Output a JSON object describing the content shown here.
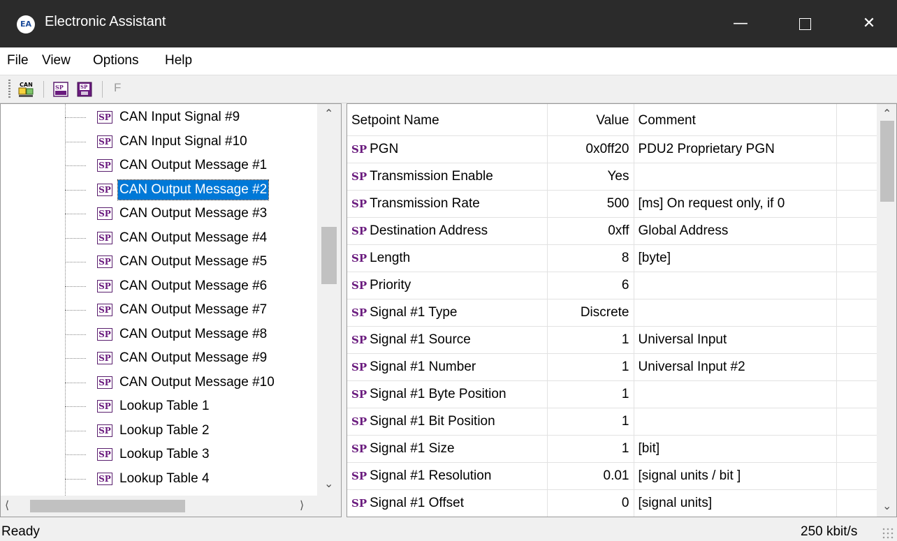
{
  "window": {
    "title": "Electronic Assistant",
    "icon": "ea-logo-icon"
  },
  "menu": [
    "File",
    "View",
    "Options",
    "Help"
  ],
  "toolbar": {
    "f_label": "F"
  },
  "tree": {
    "items": [
      "CAN Input Signal #9",
      "CAN Input Signal #10",
      "CAN Output Message #1",
      "CAN Output Message #2",
      "CAN Output Message #3",
      "CAN Output Message #4",
      "CAN Output Message #5",
      "CAN Output Message #6",
      "CAN Output Message #7",
      "CAN Output Message #8",
      "CAN Output Message #9",
      "CAN Output Message #10",
      "Lookup Table 1",
      "Lookup Table 2",
      "Lookup Table 3",
      "Lookup Table 4"
    ],
    "selected_index": 3,
    "icon_label": "SP"
  },
  "grid": {
    "columns": [
      "Setpoint Name",
      "Value",
      "Comment"
    ],
    "sp_label": "SP",
    "rows": [
      [
        "PGN",
        "0x0ff20",
        "PDU2 Proprietary PGN"
      ],
      [
        "Transmission Enable",
        "Yes",
        ""
      ],
      [
        "Transmission Rate",
        "500",
        "[ms]  On request only, if 0"
      ],
      [
        "Destination Address",
        "0xff",
        "Global Address"
      ],
      [
        "Length",
        "8",
        "[byte]"
      ],
      [
        "Priority",
        "6",
        ""
      ],
      [
        "Signal #1 Type",
        "Discrete",
        ""
      ],
      [
        "Signal #1 Source",
        "1",
        "Universal Input"
      ],
      [
        "Signal #1 Number",
        "1",
        "Universal Input #2"
      ],
      [
        "Signal #1 Byte Position",
        "1",
        ""
      ],
      [
        "Signal #1 Bit Position",
        "1",
        ""
      ],
      [
        "Signal #1 Size",
        "1",
        "[bit]"
      ],
      [
        "Signal #1 Resolution",
        "0.01",
        "[signal units / bit ]"
      ],
      [
        "Signal #1 Offset",
        "0",
        "[signal units]"
      ]
    ]
  },
  "status": {
    "left": "Ready",
    "right": "250 kbit/s"
  },
  "colors": {
    "titlebar": "#2b2b2b",
    "selection": "#0078d7",
    "sp_purple": "#6a1b7e"
  }
}
